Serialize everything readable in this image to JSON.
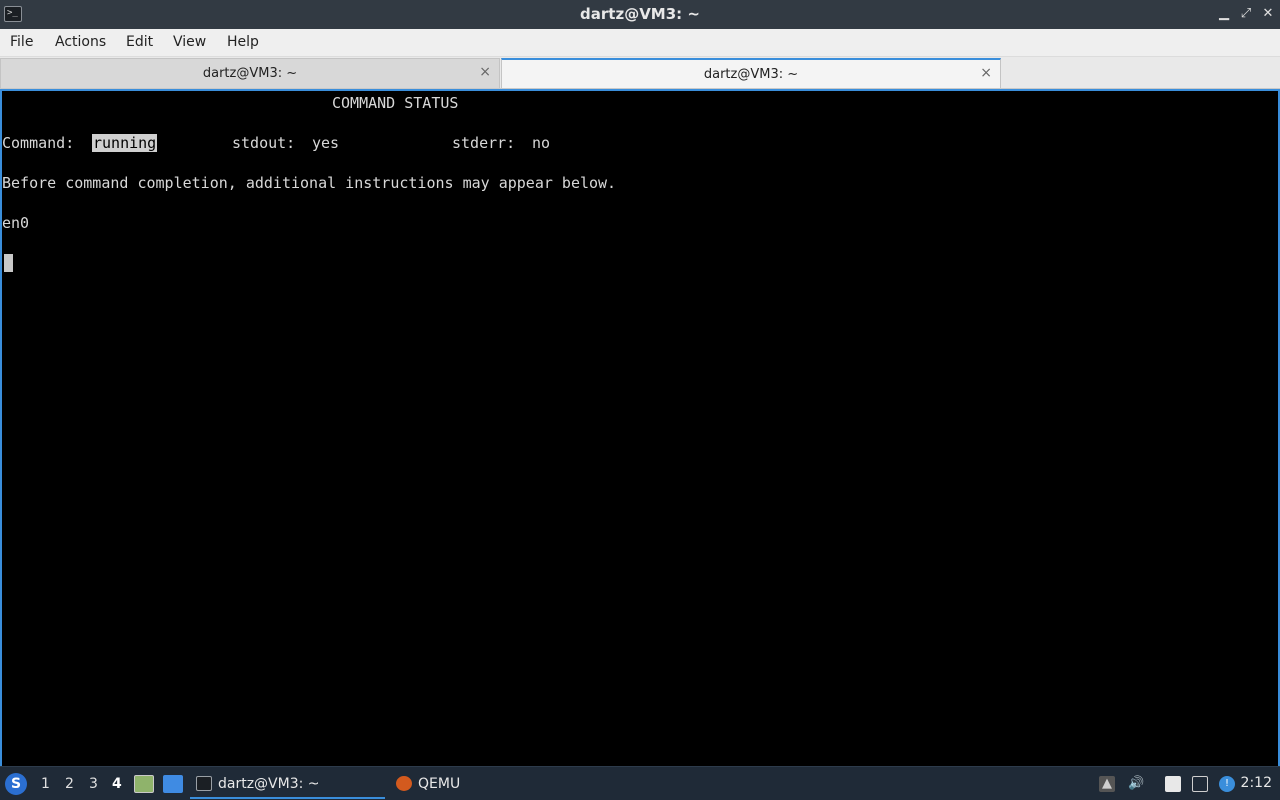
{
  "window": {
    "title": "dartz@VM3: ~",
    "controls": {
      "minimize": "▁",
      "maximize": "⤢",
      "close": "✕"
    }
  },
  "menu": [
    "File",
    "Actions",
    "Edit",
    "View",
    "Help"
  ],
  "tabs": [
    {
      "label": "dartz@VM3: ~",
      "active": false,
      "close": "×"
    },
    {
      "label": "dartz@VM3: ~",
      "active": true,
      "close": "×"
    }
  ],
  "terminal": {
    "header": "COMMAND STATUS",
    "command_label": "Command:",
    "command_value": "running",
    "stdout_label": "stdout:",
    "stdout_value": "yes",
    "stderr_label": "stderr:",
    "stderr_value": "no",
    "note": "Before command completion, additional instructions may appear below.",
    "output": "en0"
  },
  "taskbar": {
    "workspaces": [
      "1",
      "2",
      "3",
      "4"
    ],
    "active_workspace": "4",
    "tasks": [
      {
        "name": "dartz@VM3: ~",
        "icon": "terminal-icon",
        "active": true
      },
      {
        "name": "QEMU",
        "icon": "qemu-icon",
        "active": false
      }
    ],
    "clock": "2:12"
  },
  "colors": {
    "accent": "#3a8edb",
    "taskbar": "#1f2a37",
    "titlebar": "#323a43"
  }
}
